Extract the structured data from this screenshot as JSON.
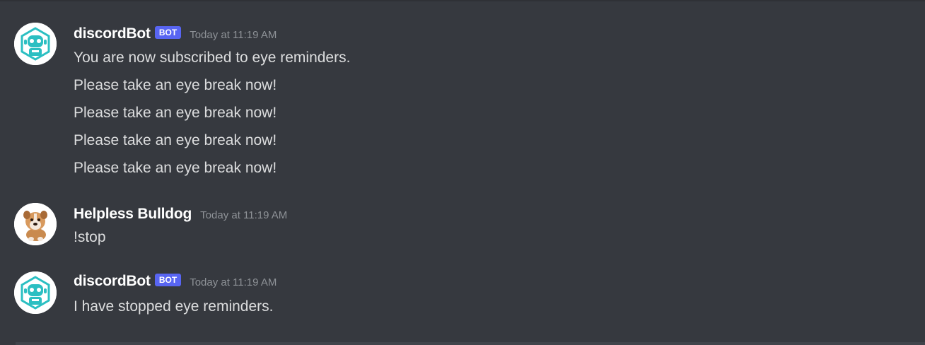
{
  "messages": [
    {
      "author": "discordBot",
      "is_bot": true,
      "tag": "BOT",
      "timestamp": "Today at 11:19 AM",
      "avatar_icon": "robot-icon",
      "lines": [
        "You are now subscribed to eye reminders.",
        "Please take an eye break now!",
        "Please take an eye break now!",
        "Please take an eye break now!",
        "Please take an eye break now!"
      ]
    },
    {
      "author": "Helpless Bulldog",
      "is_bot": false,
      "timestamp": "Today at 11:19 AM",
      "avatar_icon": "bulldog-icon",
      "lines": [
        "!stop"
      ]
    },
    {
      "author": "discordBot",
      "is_bot": true,
      "tag": "BOT",
      "timestamp": "Today at 11:19 AM",
      "avatar_icon": "robot-icon",
      "lines": [
        "I have stopped eye reminders."
      ]
    }
  ],
  "colors": {
    "background": "#36393f",
    "username": "#ffffff",
    "message_text": "#dcddde",
    "timestamp": "#8e9297",
    "bot_tag": "#5865f2",
    "bot_avatar_accent": "#2bbfc2"
  }
}
